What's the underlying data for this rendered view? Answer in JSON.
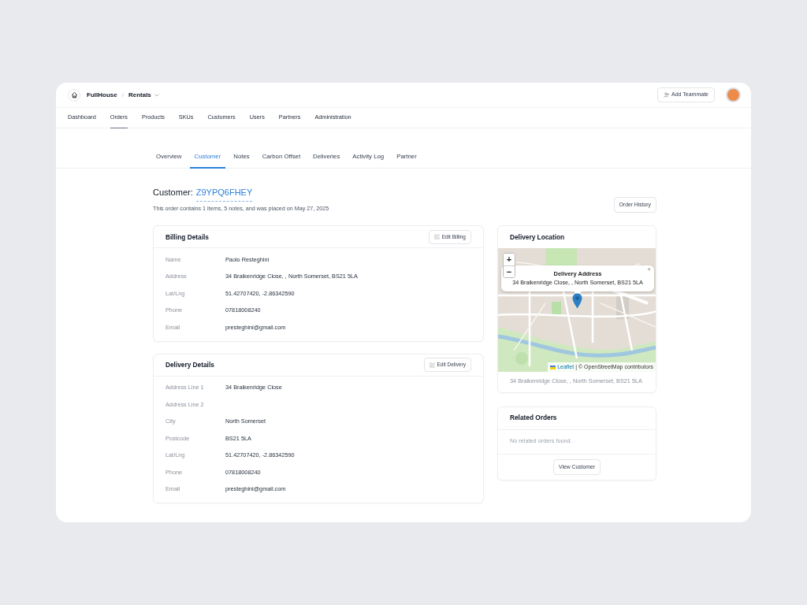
{
  "app": {
    "brand": "FullHouse",
    "separator": "/",
    "workspace": "Rentals",
    "add_button": "Add Teammate"
  },
  "nav": [
    {
      "label": "Dashboard",
      "selected": false
    },
    {
      "label": "Orders",
      "selected": true
    },
    {
      "label": "Products",
      "selected": false
    },
    {
      "label": "SKUs",
      "selected": false
    },
    {
      "label": "Customers",
      "selected": false
    },
    {
      "label": "Users",
      "selected": false
    },
    {
      "label": "Partners",
      "selected": false
    },
    {
      "label": "Administration",
      "selected": false
    }
  ],
  "tabs": [
    {
      "label": "Overview",
      "selected": false
    },
    {
      "label": "Customer",
      "selected": true
    },
    {
      "label": "Notes",
      "selected": false
    },
    {
      "label": "Carbon Offset",
      "selected": false
    },
    {
      "label": "Deliveries",
      "selected": false
    },
    {
      "label": "Activity Log",
      "selected": false
    },
    {
      "label": "Partner",
      "selected": false
    }
  ],
  "header": {
    "label": "Customer:",
    "customer_id": "Z9YPQ6FHEY",
    "summary": "This order contains 1 items, 5 notes, and was placed on May 27, 2025",
    "history_button": "Order History"
  },
  "billing": {
    "title": "Billing Details",
    "button": "Edit Billing",
    "fields": [
      {
        "label": "Name",
        "value": "Paolo Resteghini"
      },
      {
        "label": "Address",
        "value": "34 Braikenridge Close, , North Somerset, BS21 5LA"
      },
      {
        "label": "Lat/Lng",
        "value": "51.42707420, -2.86342590"
      },
      {
        "label": "Phone",
        "value": "07818008240"
      },
      {
        "label": "Email",
        "value": "presteghini@gmail.com"
      }
    ]
  },
  "delivery": {
    "title": "Delivery Details",
    "button": "Edit Delivery",
    "fields": [
      {
        "label": "Address Line 1",
        "value": "34 Braikenridge Close"
      },
      {
        "label": "Address Line 2"
      },
      {
        "label": "City",
        "value": "North Somerset"
      },
      {
        "label": "Postcode",
        "value": "BS21 5LA"
      },
      {
        "label": "Lat/Lng",
        "value": "51.42707420, -2.86342590"
      },
      {
        "label": "Phone",
        "value": "07818008240"
      },
      {
        "label": "Email",
        "value": "presteghini@gmail.com"
      }
    ]
  },
  "location": {
    "title": "Delivery Location",
    "map": {
      "kind": "picture",
      "zoom_in": "+",
      "zoom_out": "−",
      "popup_title": "Delivery Address",
      "popup_text": "34 Braikenridge Close, , North Somerset, BS21 5LA",
      "popup_close": "×",
      "attribution_link": "Leaflet",
      "attribution_text": "| © OpenStreetMap contributors"
    },
    "address": "34 Braikenridge Close, , North Somerset, BS21 5LA"
  },
  "related": {
    "title": "Related Orders",
    "empty": "No related orders found.",
    "button": "View Customer"
  }
}
